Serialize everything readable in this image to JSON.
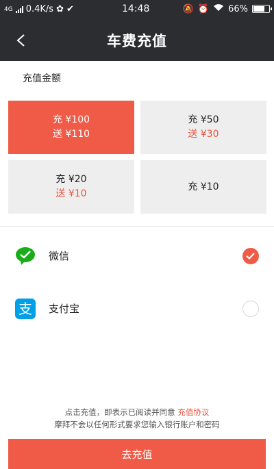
{
  "status_bar": {
    "network": "4G",
    "speed": "0.4K/s",
    "time": "14:48",
    "battery": "66%",
    "battery_level": 0.66
  },
  "header": {
    "title": "车费充值"
  },
  "amounts": {
    "section_label": "充值金额",
    "options": [
      {
        "charge": "充 ¥100",
        "bonus": "送 ¥110",
        "selected": true
      },
      {
        "charge": "充 ¥50",
        "bonus": "送 ¥30",
        "selected": false
      },
      {
        "charge": "充 ¥20",
        "bonus": "送 ¥10",
        "selected": false
      },
      {
        "charge": "充 ¥10",
        "bonus": "",
        "selected": false
      }
    ]
  },
  "payment": {
    "methods": [
      {
        "label": "微信",
        "icon": "wechat-icon",
        "checked": true
      },
      {
        "label": "支付宝",
        "icon": "alipay-icon",
        "checked": false
      }
    ]
  },
  "footer": {
    "agreement_prefix": "点击充值，即表示已阅读并同意",
    "agreement_link": "充值协议",
    "notice": "摩拜不会以任何形式要求您输入银行账户和密码",
    "submit_label": "去充值"
  },
  "colors": {
    "accent": "#ef5b47",
    "header_bg": "#2b2d31",
    "wechat": "#1aad19",
    "alipay": "#00a0e9"
  }
}
